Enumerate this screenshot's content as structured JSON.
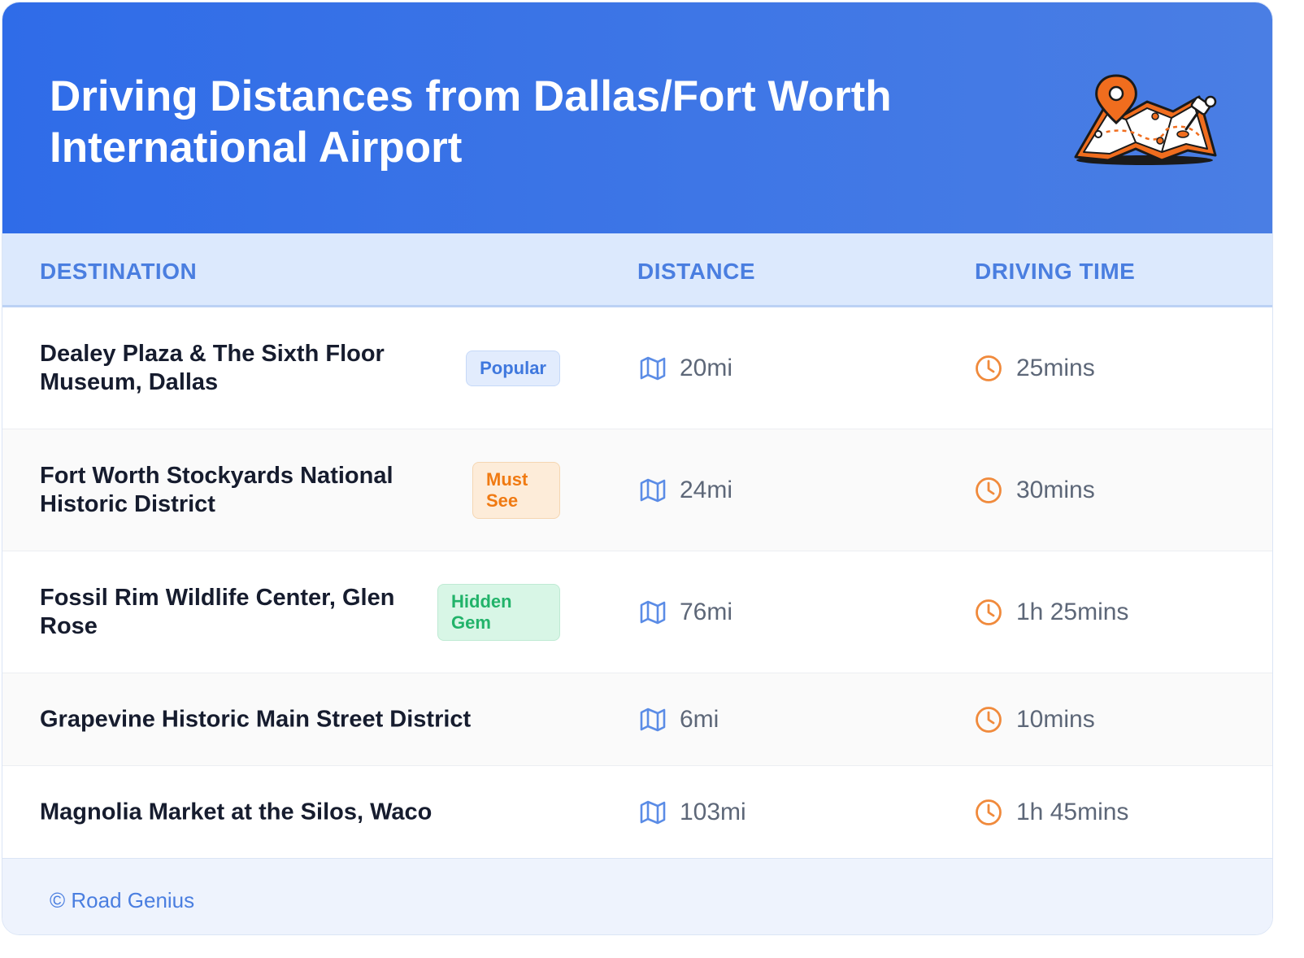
{
  "header": {
    "title": "Driving Distances from Dallas/Fort Worth International Airport",
    "illustration_icon": "map-pin-illustration-icon"
  },
  "table": {
    "columns": [
      "DESTINATION",
      "DISTANCE",
      "DRIVING TIME"
    ],
    "rows": [
      {
        "destination": "Dealey Plaza & The Sixth Floor Museum, Dallas",
        "badge": "Popular",
        "badge_type": "popular",
        "distance": "20mi",
        "time": "25mins"
      },
      {
        "destination": "Fort Worth Stockyards National Historic District",
        "badge": "Must See",
        "badge_type": "must",
        "distance": "24mi",
        "time": "30mins"
      },
      {
        "destination": "Fossil Rim Wildlife Center, Glen Rose",
        "badge": "Hidden Gem",
        "badge_type": "hidden",
        "distance": "76mi",
        "time": "1h 25mins"
      },
      {
        "destination": "Grapevine Historic Main Street District",
        "badge": "",
        "badge_type": "",
        "distance": "6mi",
        "time": "10mins"
      },
      {
        "destination": "Magnolia Market at the Silos, Waco",
        "badge": "",
        "badge_type": "",
        "distance": "103mi",
        "time": "1h 45mins"
      }
    ],
    "distance_icon": "map-icon",
    "time_icon": "clock-icon"
  },
  "footer": {
    "credit": "© Road Genius"
  },
  "colors": {
    "header_start": "#2f6ce8",
    "header_end": "#4a7ee4",
    "accent_blue": "#4a7ee0",
    "accent_orange": "#f08a3c",
    "accent_green": "#22b36a"
  }
}
